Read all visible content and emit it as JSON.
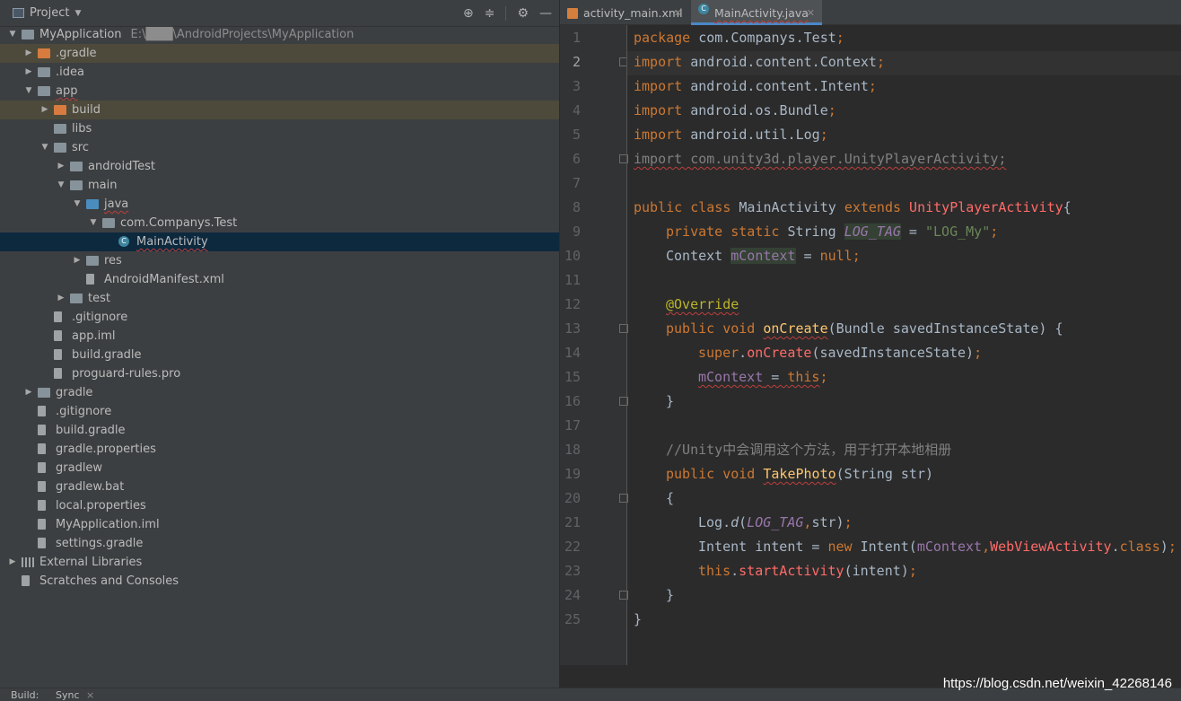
{
  "project_panel": {
    "title": "Project",
    "tree": [
      {
        "label": "MyApplication",
        "path": "E:\\███\\AndroidProjects\\MyApplication",
        "depth": 0,
        "arrow": "down",
        "icon": "module-folder-icon"
      },
      {
        "label": ".gradle",
        "depth": 1,
        "arrow": "right",
        "icon": "orange-folder-icon",
        "highlight": true
      },
      {
        "label": ".idea",
        "depth": 1,
        "arrow": "right",
        "icon": "folder-icon"
      },
      {
        "label": "app",
        "depth": 1,
        "arrow": "down",
        "icon": "module-folder-icon",
        "squiggle": true
      },
      {
        "label": "build",
        "depth": 2,
        "arrow": "right",
        "icon": "orange-folder-icon",
        "highlight": true
      },
      {
        "label": "libs",
        "depth": 2,
        "arrow": "none",
        "icon": "folder-icon"
      },
      {
        "label": "src",
        "depth": 2,
        "arrow": "down",
        "icon": "folder-icon"
      },
      {
        "label": "androidTest",
        "depth": 3,
        "arrow": "right",
        "icon": "folder-icon"
      },
      {
        "label": "main",
        "depth": 3,
        "arrow": "down",
        "icon": "folder-icon"
      },
      {
        "label": "java",
        "depth": 4,
        "arrow": "down",
        "icon": "blue-folder-icon",
        "squiggle": true
      },
      {
        "label": "com.Companys.Test",
        "depth": 5,
        "arrow": "down",
        "icon": "package-icon"
      },
      {
        "label": "MainActivity",
        "depth": 6,
        "arrow": "none",
        "icon": "class-icon",
        "selected": true,
        "squiggle": true
      },
      {
        "label": "res",
        "depth": 4,
        "arrow": "right",
        "icon": "res-folder-icon"
      },
      {
        "label": "AndroidManifest.xml",
        "depth": 4,
        "arrow": "none",
        "icon": "manifest-icon"
      },
      {
        "label": "test",
        "depth": 3,
        "arrow": "right",
        "icon": "folder-icon"
      },
      {
        "label": ".gitignore",
        "depth": 2,
        "arrow": "none",
        "icon": "file-icon"
      },
      {
        "label": "app.iml",
        "depth": 2,
        "arrow": "none",
        "icon": "iml-icon"
      },
      {
        "label": "build.gradle",
        "depth": 2,
        "arrow": "none",
        "icon": "gradle-icon"
      },
      {
        "label": "proguard-rules.pro",
        "depth": 2,
        "arrow": "none",
        "icon": "file-icon"
      },
      {
        "label": "gradle",
        "depth": 1,
        "arrow": "right",
        "icon": "folder-icon"
      },
      {
        "label": ".gitignore",
        "depth": 1,
        "arrow": "none",
        "icon": "file-icon"
      },
      {
        "label": "build.gradle",
        "depth": 1,
        "arrow": "none",
        "icon": "gradle-icon"
      },
      {
        "label": "gradle.properties",
        "depth": 1,
        "arrow": "none",
        "icon": "properties-icon"
      },
      {
        "label": "gradlew",
        "depth": 1,
        "arrow": "none",
        "icon": "file-icon"
      },
      {
        "label": "gradlew.bat",
        "depth": 1,
        "arrow": "none",
        "icon": "file-icon"
      },
      {
        "label": "local.properties",
        "depth": 1,
        "arrow": "none",
        "icon": "properties-icon"
      },
      {
        "label": "MyApplication.iml",
        "depth": 1,
        "arrow": "none",
        "icon": "iml-icon"
      },
      {
        "label": "settings.gradle",
        "depth": 1,
        "arrow": "none",
        "icon": "gradle-icon"
      },
      {
        "label": "External Libraries",
        "depth": 0,
        "arrow": "right",
        "icon": "library-icon"
      },
      {
        "label": "Scratches and Consoles",
        "depth": 0,
        "arrow": "none",
        "icon": "scratches-icon"
      }
    ]
  },
  "editor": {
    "tabs": [
      {
        "label": "activity_main.xml",
        "active": false,
        "icon": "xml-file-icon"
      },
      {
        "label": "MainActivity.java",
        "active": true,
        "icon": "java-class-icon"
      }
    ],
    "line_numbers": [
      "1",
      "2",
      "3",
      "4",
      "5",
      "6",
      "7",
      "8",
      "9",
      "10",
      "11",
      "12",
      "13",
      "14",
      "15",
      "16",
      "17",
      "18",
      "19",
      "20",
      "21",
      "22",
      "23",
      "24",
      "25"
    ],
    "current_line": 2,
    "code": {
      "l1_kw": "package",
      "l1_rest": " com.Companys.Test",
      "l1_semi": ";",
      "l2_kw": "import",
      "l2_rest": " android.content.Context",
      "l2_semi": ";",
      "l3_kw": "import",
      "l3_rest": " android.content.Intent",
      "l3_semi": ";",
      "l4_kw": "import",
      "l4_rest": " android.os.Bundle",
      "l4_semi": ";",
      "l5_kw": "import",
      "l5_rest": " android.util.Log",
      "l5_semi": ";",
      "l6_text": "import com.unity3d.player.UnityPlayerActivity;",
      "l8_kw1": "public class",
      "l8_name": " MainActivity ",
      "l8_kw2": "extends",
      "l8_super": " UnityPlayerActivity",
      "l8_brace": "{",
      "l9_kw": "private static",
      "l9_type": " String ",
      "l9_field": "LOG_TAG",
      "l9_eq": " = ",
      "l9_str": "\"LOG_My\"",
      "l9_semi": ";",
      "l10_type": "Context ",
      "l10_field": "mContext",
      "l10_eq": " = ",
      "l10_kw": "null",
      "l10_semi": ";",
      "l12_ann": "@Override",
      "l13_kw": "public void",
      "l13_sp": " ",
      "l13_name": "onCreate",
      "l13_rest": "(Bundle savedInstanceState) {",
      "l14_kw": "super",
      "l14_dot": ".",
      "l14_call": "onCreate",
      "l14_rest": "(savedInstanceState)",
      "l14_semi": ";",
      "l15_field": "mContext",
      "l15_eq": " = ",
      "l15_kw": "this",
      "l15_semi": ";",
      "l16_text": "}",
      "l18_comment": "//Unity中会调用这个方法，用于打开本地相册",
      "l19_kw": "public void",
      "l19_sp": " ",
      "l19_name": "TakePhoto",
      "l19_rest": "(String str)",
      "l20_text": "{",
      "l21_cls": "Log.",
      "l21_fn": "d",
      "l21_open": "(",
      "l21_field": "LOG_TAG",
      "l21_comma": ",",
      "l21_rest": "str)",
      "l21_semi": ";",
      "l22_type": "Intent intent = ",
      "l22_kw": "new",
      "l22_ctor": " Intent(",
      "l22_field": "mContext",
      "l22_comma": ",",
      "l22_red": "WebViewActivity",
      "l22_dot": ".",
      "l22_cls": "class",
      "l22_close": ")",
      "l22_semi": ";",
      "l23_kw": "this",
      "l23_dot": ".",
      "l23_call": "startActivity",
      "l23_rest": "(intent)",
      "l23_semi": ";",
      "l24_text": "}",
      "l25_text": "}"
    }
  },
  "bottom": {
    "build_label": "Build:",
    "sync_label": "Sync",
    "close": "×"
  },
  "watermark": "https://blog.csdn.net/weixin_42268146"
}
